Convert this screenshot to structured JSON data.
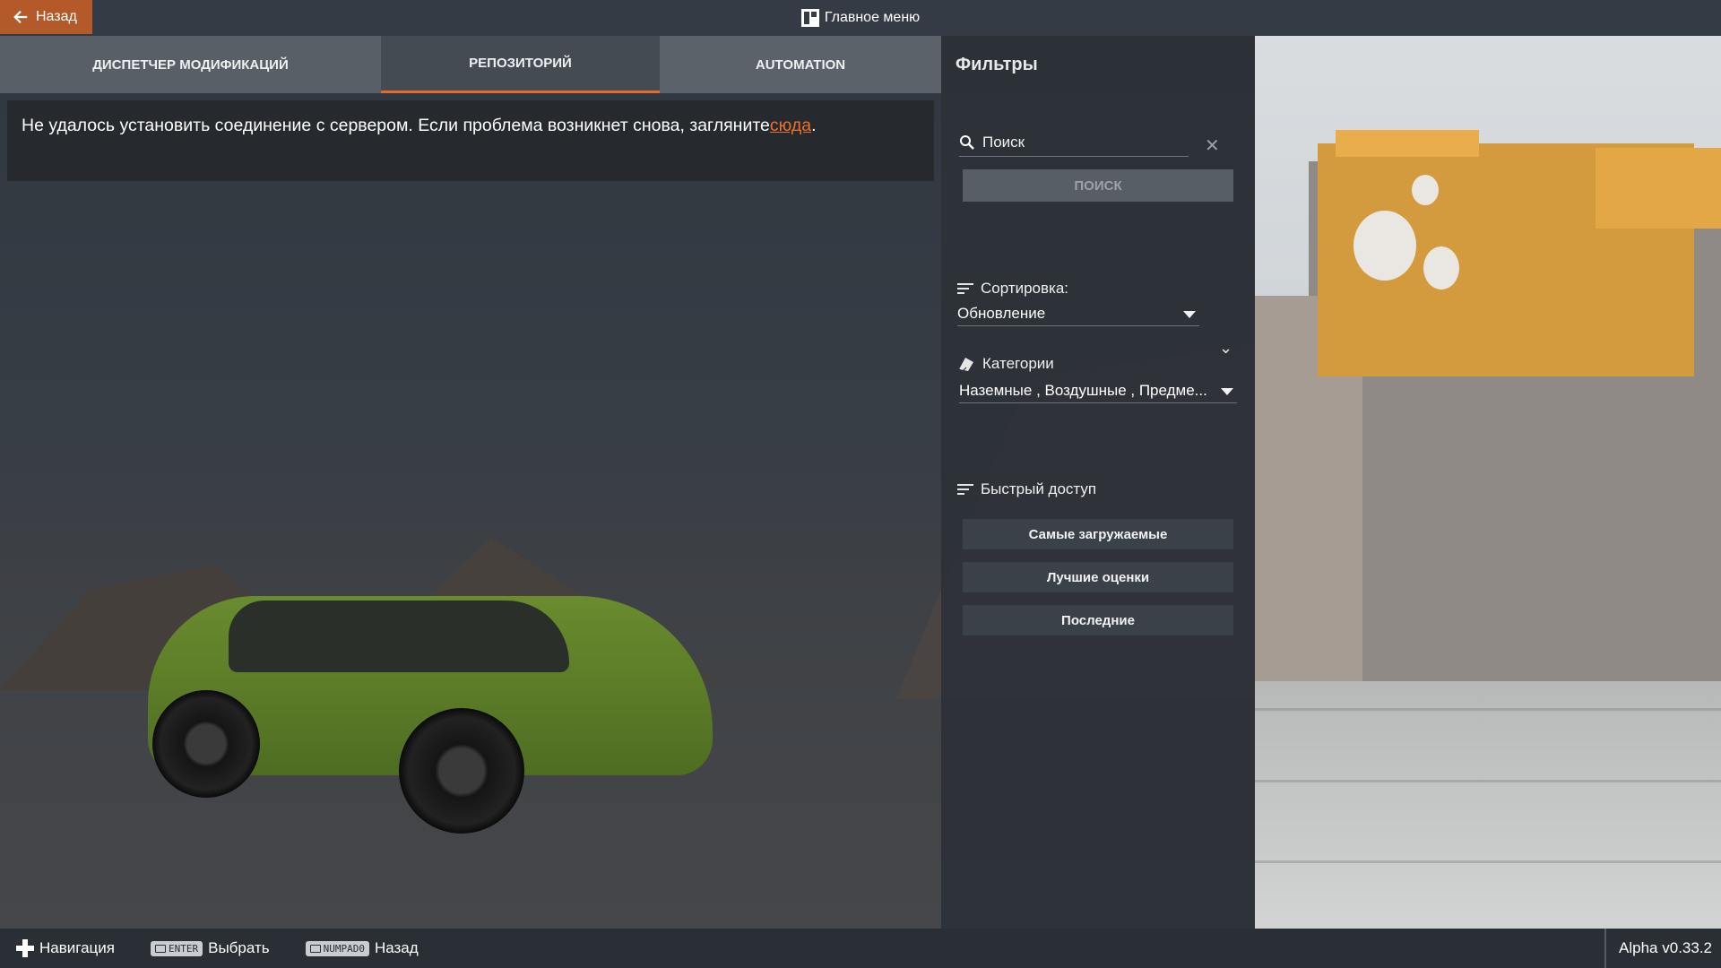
{
  "topbar": {
    "back_label": "Назад",
    "title": "Главное меню"
  },
  "tabs": [
    {
      "label": "Диспетчер модификаций",
      "active": false
    },
    {
      "label": "Репозиторий",
      "active": true
    },
    {
      "label": "Automation",
      "active": false
    }
  ],
  "error": {
    "message": "Не удалось установить соединение с сервером. Если проблема возникнет снова, загляните",
    "link": "сюда",
    "suffix": "."
  },
  "filters": {
    "title": "Фильтры",
    "search_placeholder": "Поиск",
    "search_button": "Поиск",
    "sort_label": "Сортировка:",
    "sort_value": "Обновление",
    "categories_label": "Категории",
    "categories_value": "Наземные , Воздушные , Предме...",
    "quick_label": "Быстрый доступ",
    "quick_buttons": [
      "Самые загружаемые",
      "Лучшие оценки",
      "Последние"
    ]
  },
  "bottombar": {
    "nav_label": "Навигация",
    "enter_key": "ENTER",
    "select_label": "Выбрать",
    "numpad_key": "NUMPAD0",
    "back_label": "Назад",
    "version": "Alpha v0.33.2"
  },
  "colors": {
    "accent": "#e56a2b",
    "back_button": "#b3592a",
    "link": "#e8722c",
    "panel": "#2c3137"
  }
}
